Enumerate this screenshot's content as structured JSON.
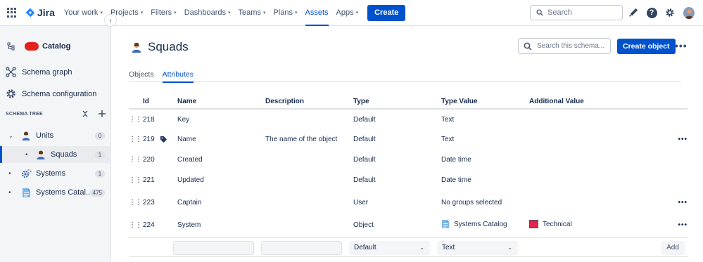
{
  "topnav": {
    "app_name": "Jira",
    "items": [
      {
        "label": "Your work",
        "has_chevron": true
      },
      {
        "label": "Projects",
        "has_chevron": true
      },
      {
        "label": "Filters",
        "has_chevron": true
      },
      {
        "label": "Dashboards",
        "has_chevron": true
      },
      {
        "label": "Teams",
        "has_chevron": true
      },
      {
        "label": "Plans",
        "has_chevron": true
      },
      {
        "label": "Assets",
        "has_chevron": false,
        "active": true
      },
      {
        "label": "Apps",
        "has_chevron": true
      }
    ],
    "create_label": "Create",
    "search_placeholder": "Search",
    "icons": [
      "app-switcher-icon",
      "notifications-icon",
      "help-icon",
      "settings-icon",
      "profile-avatar"
    ]
  },
  "sidebar": {
    "schema_name": "Catalog",
    "links": [
      {
        "label": "Schema graph",
        "icon": "schema-graph-icon"
      },
      {
        "label": "Schema configuration",
        "icon": "gear-icon"
      }
    ],
    "schema_tree_label": "SCHEMA TREE",
    "tree": [
      {
        "label": "Units",
        "count": "0",
        "expanded": true,
        "icon": "person-icon"
      },
      {
        "label": "Squads",
        "count": "1",
        "selected": true,
        "icon": "person-icon"
      },
      {
        "label": "Systems",
        "count": "1",
        "icon": "gears-icon"
      },
      {
        "label": "Systems Catal...",
        "count": "475",
        "icon": "document-icon"
      }
    ]
  },
  "main": {
    "title": "Squads",
    "search_placeholder": "Search this schema...",
    "create_object_label": "Create object",
    "tabs": [
      {
        "label": "Objects",
        "active": false
      },
      {
        "label": "Attributes",
        "active": true
      }
    ],
    "columns": [
      "Id",
      "Name",
      "Description",
      "Type",
      "Type Value",
      "Additional Value"
    ],
    "rows": [
      {
        "id": "218",
        "name": "Key",
        "description": "",
        "type": "Default",
        "type_value": "Text",
        "additional": "",
        "has_tag": false,
        "has_menu": false
      },
      {
        "id": "219",
        "name": "Name",
        "description": "The name of the object",
        "type": "Default",
        "type_value": "Text",
        "additional": "",
        "has_tag": true,
        "has_menu": true
      },
      {
        "id": "220",
        "name": "Created",
        "description": "",
        "type": "Default",
        "type_value": "Date time",
        "additional": "",
        "has_tag": false,
        "has_menu": false
      },
      {
        "id": "221",
        "name": "Updated",
        "description": "",
        "type": "Default",
        "type_value": "Date time",
        "additional": "",
        "has_tag": false,
        "has_menu": false
      },
      {
        "id": "223",
        "name": "Captain",
        "description": "",
        "type": "User",
        "type_value": "No groups selected",
        "additional": "",
        "has_tag": false,
        "has_menu": true
      },
      {
        "id": "224",
        "name": "System",
        "description": "",
        "type": "Object",
        "type_value": "Systems Catalog",
        "additional": "Technical",
        "has_tag": false,
        "has_menu": true
      }
    ],
    "new_row": {
      "type_selected": "Default",
      "type_value_selected": "Text",
      "add_label": "Add"
    }
  },
  "colors": {
    "accent": "#0052cc",
    "brand_red": "#e2231a",
    "technical_swatch": "#e2234a"
  }
}
